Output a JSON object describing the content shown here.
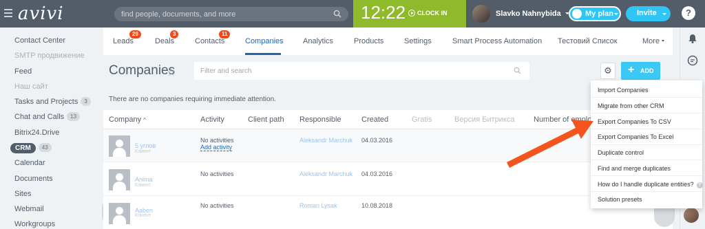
{
  "header": {
    "logo": "avivi",
    "search_placeholder": "find people, documents, and more",
    "clock_time": "12:22",
    "clock_label": "CLOCK IN",
    "user_name": "Slavko Nahnybida",
    "my_plan": "My plan",
    "invite": "Invite",
    "help": "?"
  },
  "sidebar": {
    "items": [
      {
        "label": "Contact Center"
      },
      {
        "label": "SMTP продвижение"
      },
      {
        "label": "Feed"
      },
      {
        "label": "Наш сайт"
      },
      {
        "label": "Tasks and Projects",
        "badge": "3"
      },
      {
        "label": "Chat and Calls",
        "badge": "13"
      },
      {
        "label": "Bitrix24.Drive"
      },
      {
        "label": "CRM",
        "badge": "43"
      },
      {
        "label": "Calendar"
      },
      {
        "label": "Documents"
      },
      {
        "label": "Sites"
      },
      {
        "label": "Webmail"
      },
      {
        "label": "Workgroups"
      }
    ]
  },
  "tabs": [
    {
      "label": "Leads",
      "badge": "29"
    },
    {
      "label": "Deals",
      "badge": "3"
    },
    {
      "label": "Contacts",
      "badge": "11"
    },
    {
      "label": "Companies"
    },
    {
      "label": "Analytics"
    },
    {
      "label": "Products"
    },
    {
      "label": "Settings"
    },
    {
      "label": "Smart Process Automation"
    },
    {
      "label": "Тестовий Список"
    },
    {
      "label": "More"
    }
  ],
  "page": {
    "title": "Companies",
    "filter_placeholder": "Filter and search",
    "add_label": "ADD",
    "notice": "There are no companies requiring immediate attention."
  },
  "table": {
    "columns": [
      "Company",
      "Activity",
      "Client path",
      "Responsible",
      "Created",
      "Gratis",
      "Версия Битрикса",
      "Number of employees"
    ],
    "rows": [
      {
        "company": "5 углов",
        "type": "Клиент",
        "activity": "No activities",
        "add_activity": "Add activity",
        "responsible": "Aleksandr Marchuk",
        "created": "04.03.2016"
      },
      {
        "company": "Anima",
        "type": "Клиент",
        "activity": "No activities",
        "add_activity": "",
        "responsible": "Aleksandr Marchuk",
        "created": "04.03.2016"
      },
      {
        "company": "Aaben",
        "type": "Клиент",
        "activity": "No activities",
        "add_activity": "",
        "responsible": "Roman Lysak",
        "created": "10.08.2018"
      }
    ]
  },
  "menu": {
    "items": [
      "Import Companies",
      "Migrate from other CRM",
      "Export Companies To CSV",
      "Export Companies To Excel",
      "Duplicate control",
      "Find and merge duplicates",
      "How do I handle duplicate entities?",
      "Solution presets"
    ]
  },
  "colors": {
    "topbar": "#535c69",
    "clock": "#8fba2c",
    "accent": "#2fc6f6",
    "link": "#2067b0",
    "badge": "#f54819",
    "annotation_arrow": "#f5541e"
  }
}
